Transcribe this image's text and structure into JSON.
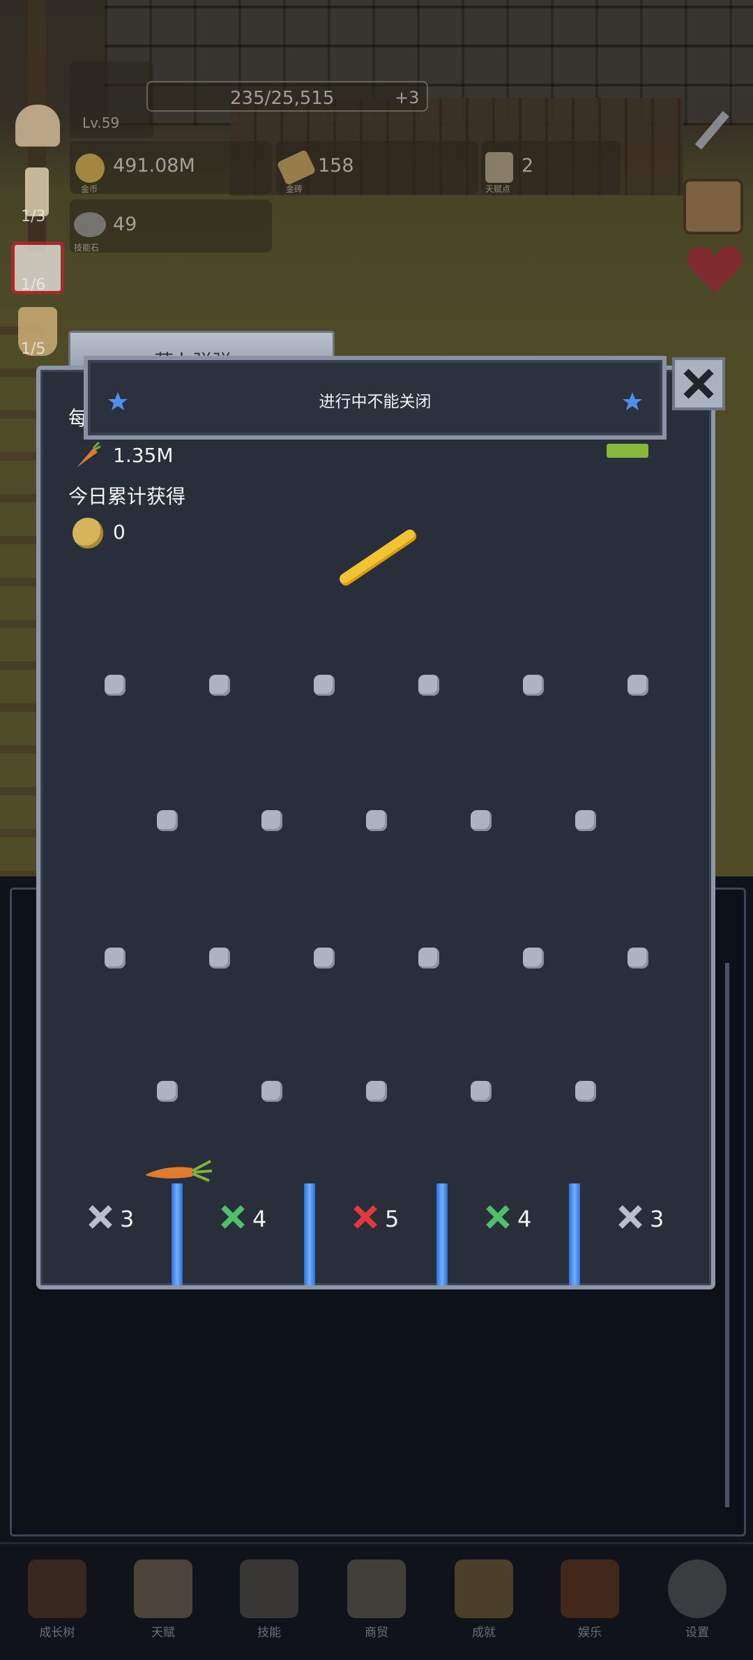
{
  "hud": {
    "level": "Lv.59",
    "exp": "235/25,515",
    "exp_bonus": "+3",
    "gold_value": "491.08M",
    "gold_caption": "金币",
    "ingot_value": "158",
    "ingot_caption": "金砖",
    "talent_value": "2",
    "talent_caption": "天赋点",
    "stone_value": "49",
    "stone_caption": "技能石"
  },
  "side": {
    "candle_count": "1/3",
    "dice_count": "1/6",
    "cup_count": "1/5"
  },
  "modal": {
    "tab_title": "萝卜弹弹",
    "header_title": "进行中不能关闭",
    "per_label_partial": "每",
    "carrot_value": "1.35M",
    "today_label": "今日累计获得",
    "coin_value": "0",
    "slots": [
      {
        "mult": "3",
        "color": "#b9c0cc"
      },
      {
        "mult": "4",
        "color": "#4fbf6a"
      },
      {
        "mult": "5",
        "color": "#e23a3a"
      },
      {
        "mult": "4",
        "color": "#4fbf6a"
      },
      {
        "mult": "3",
        "color": "#b9c0cc"
      }
    ]
  },
  "nav": {
    "items": [
      {
        "label": "成长树",
        "icon": "book-icon"
      },
      {
        "label": "天赋",
        "icon": "scroll-icon"
      },
      {
        "label": "技能",
        "icon": "sword-icon"
      },
      {
        "label": "商贸",
        "icon": "map-icon"
      },
      {
        "label": "成就",
        "icon": "key-icon"
      },
      {
        "label": "娱乐",
        "icon": "horn-icon"
      },
      {
        "label": "设置",
        "icon": "gear-icon"
      }
    ]
  },
  "colors": {
    "panel": "#282e3a",
    "frame": "#8d97a8",
    "divider": "#4a8ff0",
    "peg": "#aeb4bf",
    "stick": "#f4c430"
  }
}
